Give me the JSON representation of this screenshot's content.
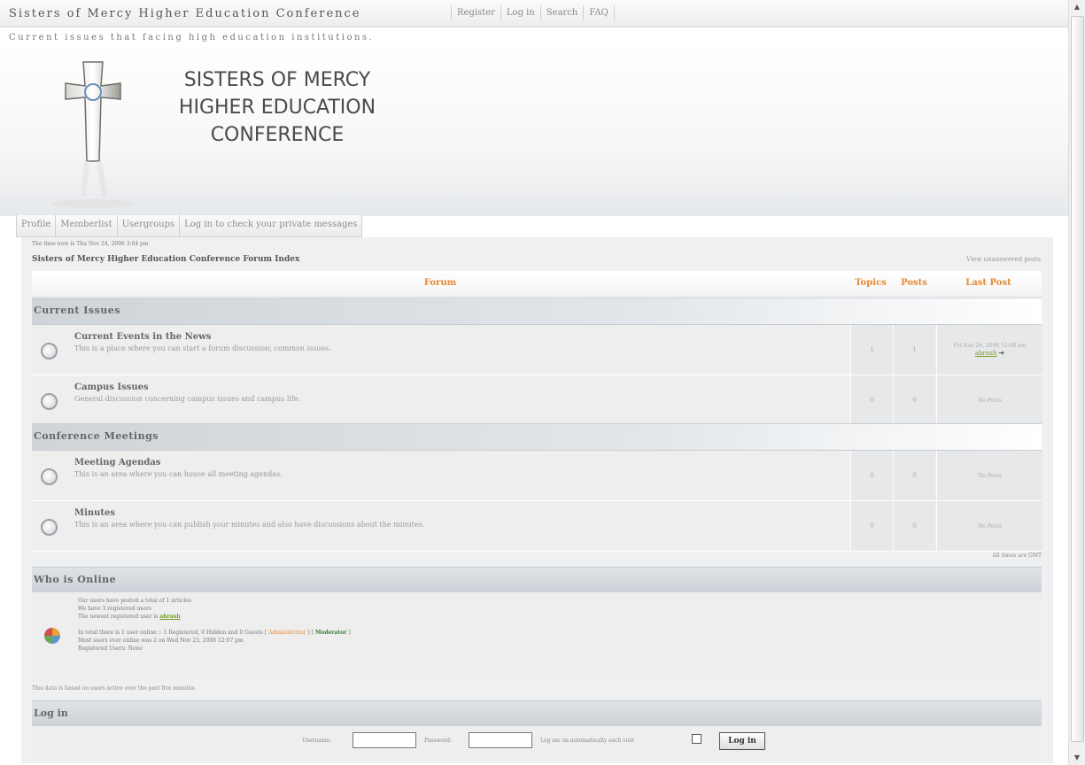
{
  "header": {
    "site_title": "Sisters of Mercy Higher Education Conference",
    "top_links": [
      "Register",
      "Log in",
      "Search",
      "FAQ"
    ],
    "tagline": "Current issues that facing high education institutions."
  },
  "logo": {
    "lines": [
      "SISTERS OF MERCY",
      "HIGHER EDUCATION",
      "CONFERENCE"
    ]
  },
  "nav_tabs": [
    "Profile",
    "Memberlist",
    "Usergroups",
    "Log in to check your private messages"
  ],
  "breadcrumb": {
    "time": "The time now is Thu Nov 24, 2006 3:04 pm",
    "index": "Sisters of Mercy Higher Education Conference Forum Index",
    "unanswered": "View unanswered posts"
  },
  "table": {
    "headers": {
      "forum": "Forum",
      "topics": "Topics",
      "posts": "Posts",
      "last_post": "Last Post"
    },
    "categories": [
      {
        "name": "Current Issues",
        "forums": [
          {
            "name": "Current Events in the News",
            "desc": "This is a place where you can start a forum discussion; common issues.",
            "topics": "1",
            "posts": "1",
            "last_post_time": "Fri Nov 24, 2006 12:00 am",
            "last_post_user": "abrush"
          },
          {
            "name": "Campus Issues",
            "desc": "General discussion concerning campus issues and campus life.",
            "topics": "0",
            "posts": "0",
            "last_post_text": "No Posts"
          }
        ]
      },
      {
        "name": "Conference Meetings",
        "forums": [
          {
            "name": "Meeting Agendas",
            "desc": "This is an area where you can house all meeting agendas.",
            "topics": "0",
            "posts": "0",
            "last_post_text": "No Posts"
          },
          {
            "name": "Minutes",
            "desc": "This is an area where you can publish your minutes and also have discussions about the minutes.",
            "topics": "0",
            "posts": "0",
            "last_post_text": "No Posts"
          }
        ]
      }
    ],
    "timezone_note": "All times are GMT"
  },
  "online": {
    "title": "Who is Online",
    "line1": "Our users have posted a total of 1 articles",
    "line2": "We have 3 registered users",
    "line3_prefix": "The newest registered user is",
    "newest_user": "abrush",
    "line4": "In total there is 1 user online :: 1 Registered, 0 Hidden and 0 Guests",
    "admin_label": "Administrator",
    "mod_label": "Moderator",
    "line5": "Most users ever online was 2 on Wed Nov 23, 2006 12:07 pm",
    "line6": "Registered Users: None",
    "active_note": "This data is based on users active over the past five minutes"
  },
  "login": {
    "title": "Log in",
    "username_label": "Username:",
    "password_label": "Password:",
    "auto_label": "Log me on automatically each visit",
    "button": "Log in"
  }
}
